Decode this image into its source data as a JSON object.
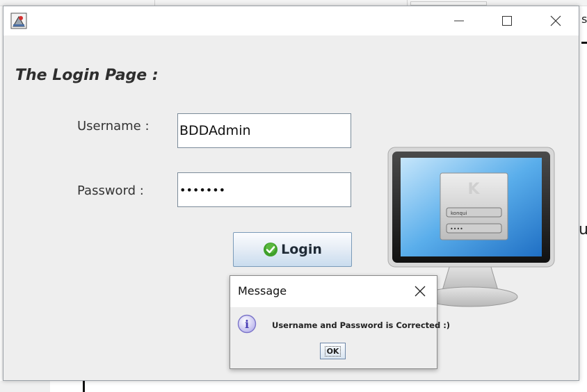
{
  "background": {
    "partial_s": "s",
    "partial_u": "u"
  },
  "window": {
    "icons": {
      "app": "java-app-icon",
      "minimize": "minimize-icon",
      "maximize": "maximize-icon",
      "close": "close-icon"
    },
    "heading": "The Login Page :",
    "username_label": "Username :",
    "username_value": "BDDAdmin",
    "password_label": "Password :",
    "password_value": "•••••••",
    "login_button": "Login",
    "login_icon": "check-icon",
    "illustration_icon": "monitor-login-icon",
    "illustration_username": "konqui",
    "illustration_password": "••••"
  },
  "dialog": {
    "title": "Message",
    "message": "Username and Password is Corrected :)",
    "ok_label": "OK",
    "icon": "info-icon"
  },
  "colors": {
    "window_bg": "#eeeeee",
    "button_gradient_bottom": "#c9dcee",
    "check_green": "#3fa02a",
    "info_purple": "#7b74c9"
  }
}
